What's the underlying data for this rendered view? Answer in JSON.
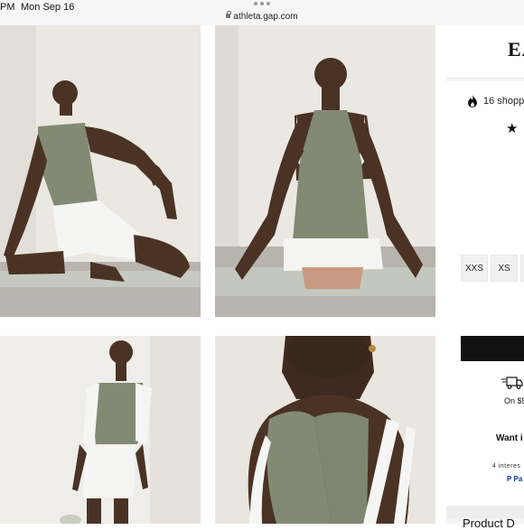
{
  "status": {
    "time": "PM",
    "date": "Mon Sep 16",
    "url": "athleta.gap.com"
  },
  "gallery": {
    "images": [
      {
        "name": "kneeling-stretch-front"
      },
      {
        "name": "seated-back-view"
      },
      {
        "name": "standing-with-jacket"
      },
      {
        "name": "back-shoulder-closeup"
      }
    ]
  },
  "product": {
    "brand": "EA",
    "shoppers": "16 shopp",
    "rating_glyph": "★",
    "sizes": [
      "XXS",
      "XS",
      ""
    ],
    "shipping": "On $5",
    "want": "Want i",
    "interest": "4 interes",
    "paypal": "P Pa",
    "details_heading": "Product D"
  },
  "colors": {
    "accent": "#111111",
    "tank": "#828a72",
    "panel_bg": "#f4f4f4"
  }
}
